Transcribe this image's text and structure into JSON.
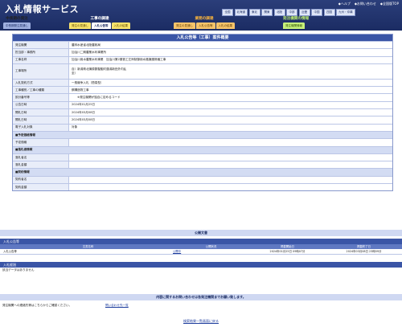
{
  "header": {
    "logo": "入札情報サービス",
    "links": [
      "◆ヘルプ",
      "◆お問い合わせ",
      "◆全国版TOP"
    ],
    "regions": [
      "全国",
      "北海道",
      "東北",
      "関東",
      "北陸",
      "中部",
      "近畿",
      "中国",
      "四国",
      "九州・沖縄"
    ]
  },
  "tab_groups": [
    {
      "title": "中長期の発注",
      "tabs": [
        "中長期発注見通し"
      ],
      "title_color": "#ffffff",
      "tab_bg": "#9fb0e0",
      "tab_fg": "#1b2c63"
    },
    {
      "title": "工事の調達",
      "tabs": [
        "発注の見通し",
        "入札公告等",
        "入札の結果"
      ],
      "title_color": "#ffffff",
      "tab_bg": "#f8e36b",
      "tab_fg": "#5a4700",
      "active": 1
    },
    {
      "title": "業務の調達",
      "tabs": [
        "発注の見通し",
        "入札公告等",
        "入札の結果"
      ],
      "title_color": "#f6b23d",
      "tab_bg": "#f7c46a",
      "tab_fg": "#5a3a00"
    },
    {
      "title": "発注機関の情報",
      "tabs": [
        "発注機関情報"
      ],
      "title_color": "#b8e86c",
      "tab_bg": "#c6f07a",
      "tab_fg": "#2d4d00"
    }
  ],
  "notice": {
    "title": "入札公告等（工事）案件概要",
    "rows": [
      {
        "label": "発注機関",
        "value": "農林水産省北陸農政局"
      },
      {
        "label": "担当部・事務所",
        "value": "加治川二期農業水利事業所"
      },
      {
        "label": "工事名称",
        "value": "加治川用水農業水利事業　加治川第2頭首工左岸制御用水路擁護修繕工事"
      },
      {
        "label": "工事場所",
        "value": "自）新潟県北蒲原郡聖籠町蓮潟新田外内乱\n至）",
        "tall": true
      },
      {
        "label": "入札契約方式",
        "value": "一般競争入札（簡易型）"
      },
      {
        "label": "工事種別／工事の種類",
        "value": "鋼構造物工事"
      },
      {
        "label": "設計番号等",
        "value": "　　※発注機関が独自に定めるコード"
      },
      {
        "label": "公告日時",
        "value": "2024年01月25日"
      },
      {
        "label": "開札日時",
        "value": "2024年03月08日"
      },
      {
        "label": "開札日時",
        "value": "2024年03月08日"
      },
      {
        "label": "電子入札対象",
        "value": "対象"
      },
      {
        "label": "■予定価格情報",
        "section": true
      },
      {
        "label": "予定価格",
        "value": ""
      },
      {
        "label": "■落札者情報",
        "section": true
      },
      {
        "label": "落札者名",
        "value": ""
      },
      {
        "label": "落札金額",
        "value": ""
      },
      {
        "label": "■契約情報",
        "section": true
      },
      {
        "label": "契約者名",
        "value": ""
      },
      {
        "label": "契約金額",
        "value": ""
      }
    ]
  },
  "files": {
    "bar_title": "公開文書",
    "section_title": "入札公告等",
    "columns": [
      "文書名称",
      "公開状況",
      "掲載開始日",
      "掲載終了日"
    ],
    "rows": [
      {
        "name": "入札公告等",
        "status": "公開中",
        "start": "2024年01月25日 09時07分",
        "end": "2024年03月08日 23時59分"
      }
    ]
  },
  "announcements": {
    "title": "入札経過",
    "body": "該当データはありません"
  },
  "contact": {
    "bar_title": "内容に関するお問い合わせは各発注機関までお願い致します。",
    "text": "発注機関への連絡先等はこちらからご確認ください。",
    "link": "問い合わせ先一覧"
  },
  "back_link": "検索結果一覧画面に戻る"
}
